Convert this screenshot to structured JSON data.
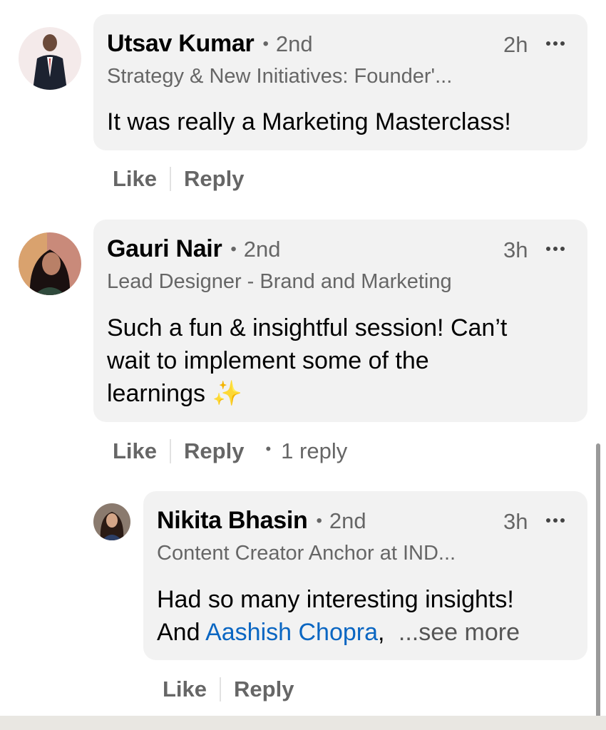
{
  "comments": [
    {
      "name": "Utsav Kumar",
      "degree": "2nd",
      "time": "2h",
      "headline": "Strategy & New Initiatives: Founder'...",
      "text": "It was really a Marketing Masterclass!",
      "like_label": "Like",
      "reply_label": "Reply"
    },
    {
      "name": "Gauri Nair",
      "degree": "2nd",
      "time": "3h",
      "headline": "Lead Designer - Brand and Marketing",
      "text_lines": [
        "Such a fun & insightful session! Can’t",
        "wait to implement some of the",
        "learnings"
      ],
      "emoji": "✨",
      "like_label": "Like",
      "reply_label": "Reply",
      "reply_count": "1 reply"
    }
  ],
  "reply": {
    "name": "Nikita Bhasin",
    "degree": "2nd",
    "time": "3h",
    "headline": "Content Creator Anchor at IND...",
    "text_line1": "Had so many interesting insights!",
    "text_line2_prefix": "And ",
    "mention": "Aashish Chopra",
    "text_line2_suffix": ",",
    "see_more": "...see more",
    "like_label": "Like",
    "reply_label": "Reply"
  },
  "colors": {
    "bubble": "#f2f2f2",
    "secondary_text": "#666666",
    "link": "#0a66c2"
  }
}
